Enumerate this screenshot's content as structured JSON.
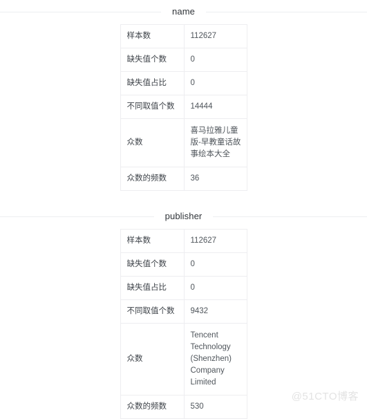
{
  "sections": [
    {
      "title": "name",
      "rows": [
        {
          "label": "样本数",
          "value": "112627"
        },
        {
          "label": "缺失值个数",
          "value": "0"
        },
        {
          "label": "缺失值占比",
          "value": "0"
        },
        {
          "label": "不同取值个数",
          "value": "14444"
        },
        {
          "label": "众数",
          "value": "喜马拉雅儿童版-早教童话故事绘本大全"
        },
        {
          "label": "众数的频数",
          "value": "36"
        }
      ]
    },
    {
      "title": "publisher",
      "rows": [
        {
          "label": "样本数",
          "value": "112627"
        },
        {
          "label": "缺失值个数",
          "value": "0"
        },
        {
          "label": "缺失值占比",
          "value": "0"
        },
        {
          "label": "不同取值个数",
          "value": "9432"
        },
        {
          "label": "众数",
          "value": "Tencent Technology (Shenzhen) Company Limited"
        },
        {
          "label": "众数的频数",
          "value": "530"
        }
      ]
    }
  ],
  "watermark": {
    "text": "@51CTO博客"
  },
  "colors": {
    "background": "#ffffff",
    "border": "#ededf0",
    "divider": "#eceef0",
    "text": "#4a4f55",
    "title": "#2f3338",
    "watermark": "#e3e3e3"
  }
}
